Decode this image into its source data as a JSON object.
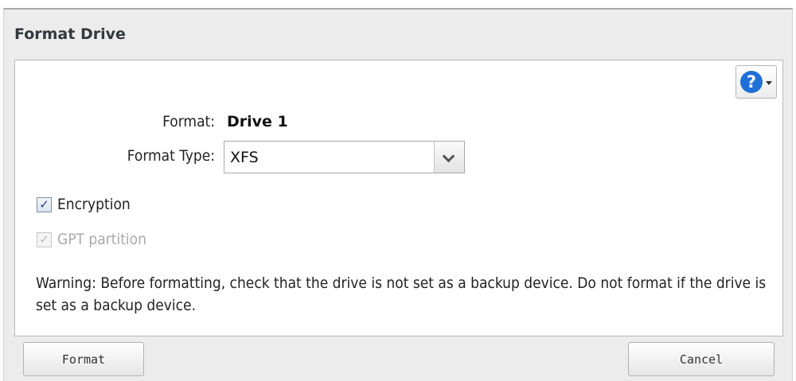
{
  "dialog": {
    "title": "Format Drive"
  },
  "help": {
    "icon": "help-question-icon",
    "glyph": "?",
    "icon_color": "#1f6fd6"
  },
  "form": {
    "format_label": "Format:",
    "format_value": "Drive 1",
    "format_type_label": "Format Type:",
    "format_type_value": "XFS"
  },
  "options": {
    "encryption_label": "Encryption",
    "encryption_checked": true,
    "gpt_label": "GPT partition",
    "gpt_checked": true,
    "gpt_disabled": true
  },
  "warning": "Warning: Before formatting, check that the drive is not set as a backup device. Do not format if the drive is set as a backup device.",
  "buttons": {
    "format_label": "Format",
    "cancel_label": "Cancel"
  }
}
